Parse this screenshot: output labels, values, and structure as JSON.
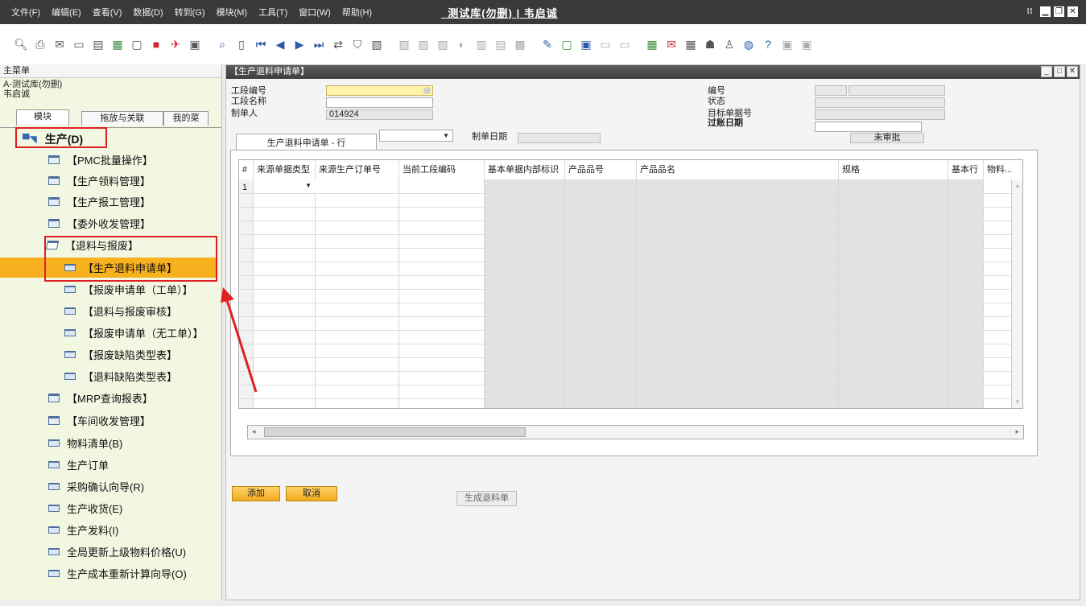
{
  "menubar": {
    "items": [
      "文件(F)",
      "编辑(E)",
      "查看(V)",
      "数据(D)",
      "转到(G)",
      "模块(M)",
      "工具(T)",
      "窗口(W)",
      "帮助(H)"
    ],
    "title": "_测试库(勿删) | 韦启诚"
  },
  "toolbar": {
    "icons": [
      "preview-icon",
      "print-icon",
      "email-icon",
      "sms-icon",
      "fax-icon",
      "excel-icon",
      "word-icon",
      "pdf-icon",
      "launch-icon",
      "lock-icon",
      "find-icon",
      "add-icon",
      "first-record-icon",
      "previous-record-icon",
      "next-record-icon",
      "last-record-icon",
      "refresh-icon",
      "filter-icon",
      "sort-icon",
      "base-document-icon",
      "target-document-icon",
      "copy-icon",
      "gross-profit-icon",
      "volume-icon",
      "payment-icon",
      "layout-icon",
      "form-settings-icon",
      "edit-icon",
      "new-doc-icon",
      "message-icon",
      "alert-icon",
      "calendar-icon",
      "mail-icon",
      "calculator-icon",
      "org-icon",
      "user-icon",
      "browser-icon",
      "help-icon",
      "settings-icon",
      "settings2-icon"
    ]
  },
  "left_panel": {
    "title": "主菜单",
    "db_name": "A-测试库(勿删)",
    "user_name": "韦启诚",
    "tabs": [
      "模块",
      "拖放与关联",
      "我的菜"
    ],
    "root": "生产(D)",
    "items": [
      {
        "label": "【PMC批量操作】"
      },
      {
        "label": "【生产领料管理】"
      },
      {
        "label": "【生产报工管理】"
      },
      {
        "label": "【委外收发管理】"
      },
      {
        "label": "【退料与报废】"
      },
      {
        "label": "【生产退料申请单】"
      },
      {
        "label": "【报废申请单（工单）】"
      },
      {
        "label": "【退料与报废审核】"
      },
      {
        "label": "【报废申请单（无工单）】"
      },
      {
        "label": "【报废缺陷类型表】"
      },
      {
        "label": "【退料缺陷类型表】"
      },
      {
        "label": "【MRP查询报表】"
      },
      {
        "label": "【车间收发管理】"
      },
      {
        "label": "物料清单(B)"
      },
      {
        "label": "生产订单"
      },
      {
        "label": "采购确认向导(R)"
      },
      {
        "label": "生产收货(E)"
      },
      {
        "label": "生产发料(I)"
      },
      {
        "label": "全局更新上级物料价格(U)"
      },
      {
        "label": "生产成本重新计算向导(O)"
      }
    ]
  },
  "document": {
    "title": "【生产退料申请单】",
    "fields": {
      "stage_code_label": "工段编号",
      "stage_name_label": "工段名称",
      "creator_label": "制单人",
      "creator_value": "014924",
      "number_label": "编号",
      "status_label": "状态",
      "target_doc_label": "目标单据号",
      "posting_date_label": "过账日期",
      "create_date_label": "制单日期",
      "approval_status": "未审批"
    },
    "tab_label": "生产退料申请单 - 行",
    "grid": {
      "headers": [
        "#",
        "来源单据类型",
        "来源生产订单号",
        "当前工段编码",
        "基本单据内部标识",
        "产品品号",
        "产品品名",
        "规格",
        "基本行",
        "物料..."
      ],
      "first_row_num": "1"
    },
    "buttons": {
      "add": "添加",
      "cancel": "取消",
      "generate": "生成退料单"
    }
  },
  "colors": {
    "selection": "#f7b01e",
    "annotation": "#e02020",
    "left_bg": "#f2f7e2"
  }
}
